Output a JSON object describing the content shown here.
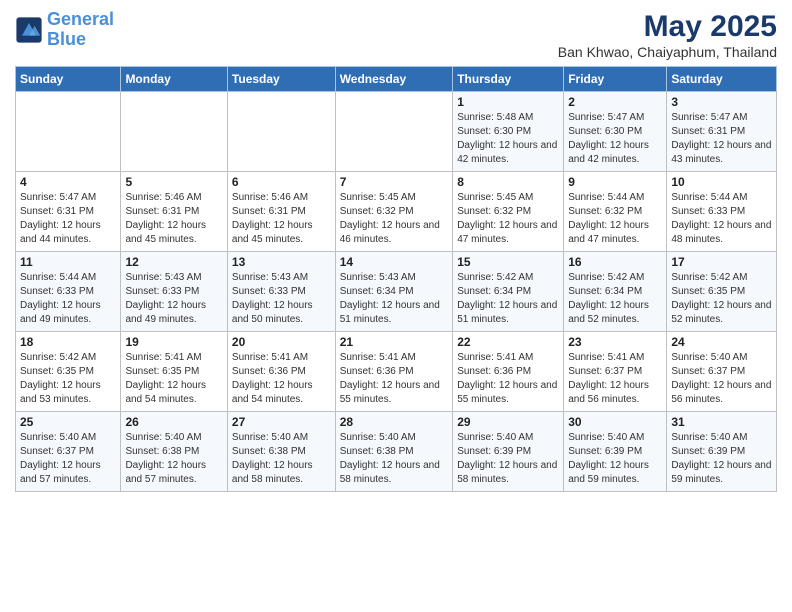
{
  "logo": {
    "line1": "General",
    "line2": "Blue"
  },
  "title": "May 2025",
  "subtitle": "Ban Khwao, Chaiyaphum, Thailand",
  "headers": [
    "Sunday",
    "Monday",
    "Tuesday",
    "Wednesday",
    "Thursday",
    "Friday",
    "Saturday"
  ],
  "weeks": [
    [
      {
        "day": "",
        "text": ""
      },
      {
        "day": "",
        "text": ""
      },
      {
        "day": "",
        "text": ""
      },
      {
        "day": "",
        "text": ""
      },
      {
        "day": "1",
        "text": "Sunrise: 5:48 AM\nSunset: 6:30 PM\nDaylight: 12 hours and 42 minutes."
      },
      {
        "day": "2",
        "text": "Sunrise: 5:47 AM\nSunset: 6:30 PM\nDaylight: 12 hours and 42 minutes."
      },
      {
        "day": "3",
        "text": "Sunrise: 5:47 AM\nSunset: 6:31 PM\nDaylight: 12 hours and 43 minutes."
      }
    ],
    [
      {
        "day": "4",
        "text": "Sunrise: 5:47 AM\nSunset: 6:31 PM\nDaylight: 12 hours and 44 minutes."
      },
      {
        "day": "5",
        "text": "Sunrise: 5:46 AM\nSunset: 6:31 PM\nDaylight: 12 hours and 45 minutes."
      },
      {
        "day": "6",
        "text": "Sunrise: 5:46 AM\nSunset: 6:31 PM\nDaylight: 12 hours and 45 minutes."
      },
      {
        "day": "7",
        "text": "Sunrise: 5:45 AM\nSunset: 6:32 PM\nDaylight: 12 hours and 46 minutes."
      },
      {
        "day": "8",
        "text": "Sunrise: 5:45 AM\nSunset: 6:32 PM\nDaylight: 12 hours and 47 minutes."
      },
      {
        "day": "9",
        "text": "Sunrise: 5:44 AM\nSunset: 6:32 PM\nDaylight: 12 hours and 47 minutes."
      },
      {
        "day": "10",
        "text": "Sunrise: 5:44 AM\nSunset: 6:33 PM\nDaylight: 12 hours and 48 minutes."
      }
    ],
    [
      {
        "day": "11",
        "text": "Sunrise: 5:44 AM\nSunset: 6:33 PM\nDaylight: 12 hours and 49 minutes."
      },
      {
        "day": "12",
        "text": "Sunrise: 5:43 AM\nSunset: 6:33 PM\nDaylight: 12 hours and 49 minutes."
      },
      {
        "day": "13",
        "text": "Sunrise: 5:43 AM\nSunset: 6:33 PM\nDaylight: 12 hours and 50 minutes."
      },
      {
        "day": "14",
        "text": "Sunrise: 5:43 AM\nSunset: 6:34 PM\nDaylight: 12 hours and 51 minutes."
      },
      {
        "day": "15",
        "text": "Sunrise: 5:42 AM\nSunset: 6:34 PM\nDaylight: 12 hours and 51 minutes."
      },
      {
        "day": "16",
        "text": "Sunrise: 5:42 AM\nSunset: 6:34 PM\nDaylight: 12 hours and 52 minutes."
      },
      {
        "day": "17",
        "text": "Sunrise: 5:42 AM\nSunset: 6:35 PM\nDaylight: 12 hours and 52 minutes."
      }
    ],
    [
      {
        "day": "18",
        "text": "Sunrise: 5:42 AM\nSunset: 6:35 PM\nDaylight: 12 hours and 53 minutes."
      },
      {
        "day": "19",
        "text": "Sunrise: 5:41 AM\nSunset: 6:35 PM\nDaylight: 12 hours and 54 minutes."
      },
      {
        "day": "20",
        "text": "Sunrise: 5:41 AM\nSunset: 6:36 PM\nDaylight: 12 hours and 54 minutes."
      },
      {
        "day": "21",
        "text": "Sunrise: 5:41 AM\nSunset: 6:36 PM\nDaylight: 12 hours and 55 minutes."
      },
      {
        "day": "22",
        "text": "Sunrise: 5:41 AM\nSunset: 6:36 PM\nDaylight: 12 hours and 55 minutes."
      },
      {
        "day": "23",
        "text": "Sunrise: 5:41 AM\nSunset: 6:37 PM\nDaylight: 12 hours and 56 minutes."
      },
      {
        "day": "24",
        "text": "Sunrise: 5:40 AM\nSunset: 6:37 PM\nDaylight: 12 hours and 56 minutes."
      }
    ],
    [
      {
        "day": "25",
        "text": "Sunrise: 5:40 AM\nSunset: 6:37 PM\nDaylight: 12 hours and 57 minutes."
      },
      {
        "day": "26",
        "text": "Sunrise: 5:40 AM\nSunset: 6:38 PM\nDaylight: 12 hours and 57 minutes."
      },
      {
        "day": "27",
        "text": "Sunrise: 5:40 AM\nSunset: 6:38 PM\nDaylight: 12 hours and 58 minutes."
      },
      {
        "day": "28",
        "text": "Sunrise: 5:40 AM\nSunset: 6:38 PM\nDaylight: 12 hours and 58 minutes."
      },
      {
        "day": "29",
        "text": "Sunrise: 5:40 AM\nSunset: 6:39 PM\nDaylight: 12 hours and 58 minutes."
      },
      {
        "day": "30",
        "text": "Sunrise: 5:40 AM\nSunset: 6:39 PM\nDaylight: 12 hours and 59 minutes."
      },
      {
        "day": "31",
        "text": "Sunrise: 5:40 AM\nSunset: 6:39 PM\nDaylight: 12 hours and 59 minutes."
      }
    ]
  ]
}
